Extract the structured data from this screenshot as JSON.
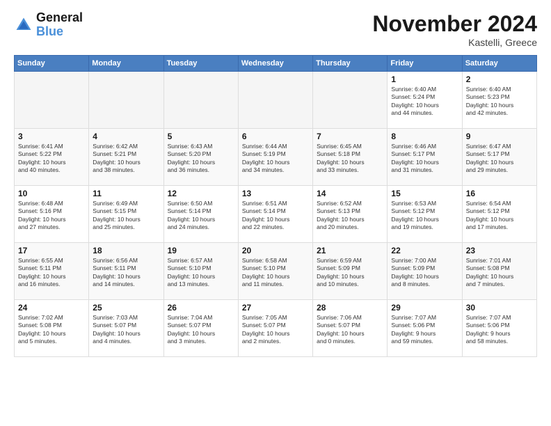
{
  "header": {
    "logo_line1": "General",
    "logo_line2": "Blue",
    "title": "November 2024",
    "location": "Kastelli, Greece"
  },
  "weekdays": [
    "Sunday",
    "Monday",
    "Tuesday",
    "Wednesday",
    "Thursday",
    "Friday",
    "Saturday"
  ],
  "weeks": [
    [
      {
        "day": "",
        "info": ""
      },
      {
        "day": "",
        "info": ""
      },
      {
        "day": "",
        "info": ""
      },
      {
        "day": "",
        "info": ""
      },
      {
        "day": "",
        "info": ""
      },
      {
        "day": "1",
        "info": "Sunrise: 6:40 AM\nSunset: 5:24 PM\nDaylight: 10 hours\nand 44 minutes."
      },
      {
        "day": "2",
        "info": "Sunrise: 6:40 AM\nSunset: 5:23 PM\nDaylight: 10 hours\nand 42 minutes."
      }
    ],
    [
      {
        "day": "3",
        "info": "Sunrise: 6:41 AM\nSunset: 5:22 PM\nDaylight: 10 hours\nand 40 minutes."
      },
      {
        "day": "4",
        "info": "Sunrise: 6:42 AM\nSunset: 5:21 PM\nDaylight: 10 hours\nand 38 minutes."
      },
      {
        "day": "5",
        "info": "Sunrise: 6:43 AM\nSunset: 5:20 PM\nDaylight: 10 hours\nand 36 minutes."
      },
      {
        "day": "6",
        "info": "Sunrise: 6:44 AM\nSunset: 5:19 PM\nDaylight: 10 hours\nand 34 minutes."
      },
      {
        "day": "7",
        "info": "Sunrise: 6:45 AM\nSunset: 5:18 PM\nDaylight: 10 hours\nand 33 minutes."
      },
      {
        "day": "8",
        "info": "Sunrise: 6:46 AM\nSunset: 5:17 PM\nDaylight: 10 hours\nand 31 minutes."
      },
      {
        "day": "9",
        "info": "Sunrise: 6:47 AM\nSunset: 5:17 PM\nDaylight: 10 hours\nand 29 minutes."
      }
    ],
    [
      {
        "day": "10",
        "info": "Sunrise: 6:48 AM\nSunset: 5:16 PM\nDaylight: 10 hours\nand 27 minutes."
      },
      {
        "day": "11",
        "info": "Sunrise: 6:49 AM\nSunset: 5:15 PM\nDaylight: 10 hours\nand 25 minutes."
      },
      {
        "day": "12",
        "info": "Sunrise: 6:50 AM\nSunset: 5:14 PM\nDaylight: 10 hours\nand 24 minutes."
      },
      {
        "day": "13",
        "info": "Sunrise: 6:51 AM\nSunset: 5:14 PM\nDaylight: 10 hours\nand 22 minutes."
      },
      {
        "day": "14",
        "info": "Sunrise: 6:52 AM\nSunset: 5:13 PM\nDaylight: 10 hours\nand 20 minutes."
      },
      {
        "day": "15",
        "info": "Sunrise: 6:53 AM\nSunset: 5:12 PM\nDaylight: 10 hours\nand 19 minutes."
      },
      {
        "day": "16",
        "info": "Sunrise: 6:54 AM\nSunset: 5:12 PM\nDaylight: 10 hours\nand 17 minutes."
      }
    ],
    [
      {
        "day": "17",
        "info": "Sunrise: 6:55 AM\nSunset: 5:11 PM\nDaylight: 10 hours\nand 16 minutes."
      },
      {
        "day": "18",
        "info": "Sunrise: 6:56 AM\nSunset: 5:11 PM\nDaylight: 10 hours\nand 14 minutes."
      },
      {
        "day": "19",
        "info": "Sunrise: 6:57 AM\nSunset: 5:10 PM\nDaylight: 10 hours\nand 13 minutes."
      },
      {
        "day": "20",
        "info": "Sunrise: 6:58 AM\nSunset: 5:10 PM\nDaylight: 10 hours\nand 11 minutes."
      },
      {
        "day": "21",
        "info": "Sunrise: 6:59 AM\nSunset: 5:09 PM\nDaylight: 10 hours\nand 10 minutes."
      },
      {
        "day": "22",
        "info": "Sunrise: 7:00 AM\nSunset: 5:09 PM\nDaylight: 10 hours\nand 8 minutes."
      },
      {
        "day": "23",
        "info": "Sunrise: 7:01 AM\nSunset: 5:08 PM\nDaylight: 10 hours\nand 7 minutes."
      }
    ],
    [
      {
        "day": "24",
        "info": "Sunrise: 7:02 AM\nSunset: 5:08 PM\nDaylight: 10 hours\nand 5 minutes."
      },
      {
        "day": "25",
        "info": "Sunrise: 7:03 AM\nSunset: 5:07 PM\nDaylight: 10 hours\nand 4 minutes."
      },
      {
        "day": "26",
        "info": "Sunrise: 7:04 AM\nSunset: 5:07 PM\nDaylight: 10 hours\nand 3 minutes."
      },
      {
        "day": "27",
        "info": "Sunrise: 7:05 AM\nSunset: 5:07 PM\nDaylight: 10 hours\nand 2 minutes."
      },
      {
        "day": "28",
        "info": "Sunrise: 7:06 AM\nSunset: 5:07 PM\nDaylight: 10 hours\nand 0 minutes."
      },
      {
        "day": "29",
        "info": "Sunrise: 7:07 AM\nSunset: 5:06 PM\nDaylight: 9 hours\nand 59 minutes."
      },
      {
        "day": "30",
        "info": "Sunrise: 7:07 AM\nSunset: 5:06 PM\nDaylight: 9 hours\nand 58 minutes."
      }
    ]
  ]
}
